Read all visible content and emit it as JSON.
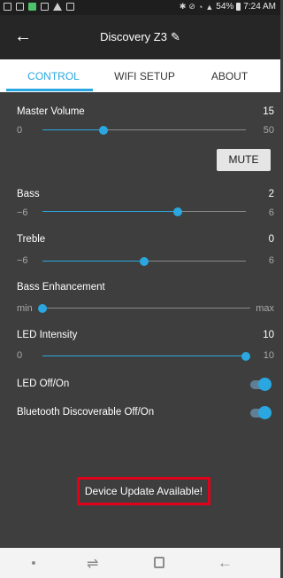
{
  "status_bar": {
    "signal_text": "54%",
    "time": "7:24 AM"
  },
  "app_bar": {
    "title": "Discovery Z3",
    "back_icon": "arrow-left",
    "edit_icon": "pencil"
  },
  "tabs": [
    {
      "label": "CONTROL",
      "active": true
    },
    {
      "label": "WIFI SETUP",
      "active": false
    },
    {
      "label": "ABOUT",
      "active": false
    }
  ],
  "controls": {
    "master_volume": {
      "label": "Master Volume",
      "value": "15",
      "min": "0",
      "max": "50",
      "level": 0.3
    },
    "mute_label": "MUTE",
    "bass": {
      "label": "Bass",
      "value": "2",
      "min": "−6",
      "max": "6",
      "level": 0.667
    },
    "treble": {
      "label": "Treble",
      "value": "0",
      "min": "−6",
      "max": "6",
      "level": 0.5
    },
    "bass_enhancement": {
      "label": "Bass Enhancement",
      "min": "min",
      "max": "max",
      "level": 0.0
    },
    "led_intensity": {
      "label": "LED Intensity",
      "value": "10",
      "min": "0",
      "max": "10",
      "level": 1.0
    },
    "led_toggle": {
      "label": "LED Off/On",
      "on": true
    },
    "bt_toggle": {
      "label": "Bluetooth Discoverable Off/On",
      "on": true
    }
  },
  "update_notice": "Device Update Available!",
  "colors": {
    "accent": "#2aa7e0",
    "background": "#3e3e3e",
    "highlight_box": "#e2001a"
  }
}
